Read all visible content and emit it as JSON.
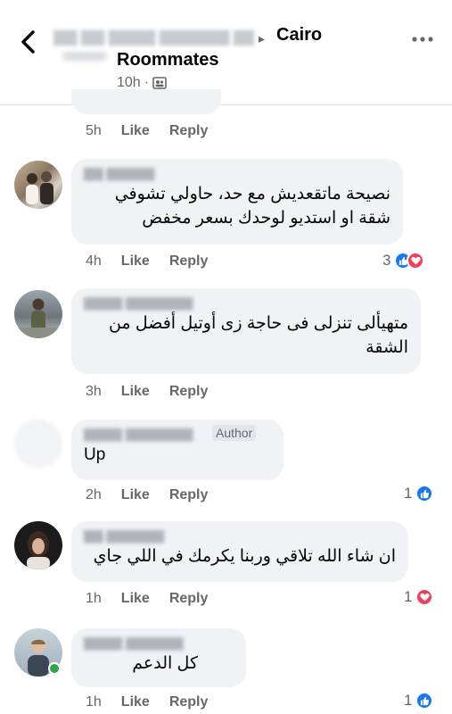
{
  "header": {
    "title": "Cairo",
    "subtitle": "Roommates",
    "time": "10h",
    "dot": "·",
    "arrow": "▸"
  },
  "top_actions": {
    "time": "5h",
    "like": "Like",
    "reply": "Reply"
  },
  "comments": [
    {
      "text_lines": [
        "نصيحة ماتقعديش مع حد، حاولي تشوفي",
        "شقة او استديو لوحدك بسعر مخفض"
      ],
      "time": "4h",
      "like": "Like",
      "reply": "Reply",
      "reaction_count": "3",
      "reactions": [
        "like-icon",
        "love-icon"
      ]
    },
    {
      "text_lines": [
        "متهيألى تنزلى فى حاجة زى أوتيل أفضل من",
        "الشقة"
      ],
      "time": "3h",
      "like": "Like",
      "reply": "Reply",
      "reaction_count": "",
      "reactions": []
    },
    {
      "badge": "Author",
      "text_lines": [
        "Up"
      ],
      "time": "2h",
      "like": "Like",
      "reply": "Reply",
      "reaction_count": "1",
      "reactions": [
        "like-icon"
      ]
    },
    {
      "text_lines": [
        "ان شاء الله تلاقي وربنا يكرمك في اللي جاي"
      ],
      "time": "1h",
      "like": "Like",
      "reply": "Reply",
      "reaction_count": "1",
      "reactions": [
        "love-icon"
      ]
    },
    {
      "text_lines": [
        "كل الدعم"
      ],
      "time": "1h",
      "like": "Like",
      "reply": "Reply",
      "reaction_count": "1",
      "reactions": [
        "like-icon"
      ]
    }
  ],
  "colors": {
    "like": "#1877f2",
    "love": "#f33e58",
    "bubble": "#f0f2f5",
    "muted": "#65676b",
    "online": "#31a24c"
  }
}
